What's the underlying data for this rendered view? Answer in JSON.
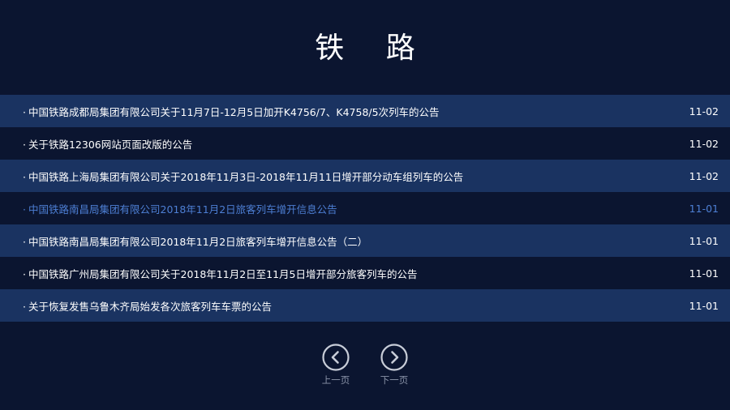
{
  "page_title": "铁 路",
  "notices": [
    {
      "title": "中国铁路成都局集团有限公司关于11月7日-12月5日加开K4756/7、K4758/5次列车的公告",
      "date": "11-02",
      "active": false
    },
    {
      "title": "关于铁路12306网站页面改版的公告",
      "date": "11-02",
      "active": false
    },
    {
      "title": "中国铁路上海局集团有限公司关于2018年11月3日-2018年11月11日增开部分动车组列车的公告",
      "date": "11-02",
      "active": false
    },
    {
      "title": "中国铁路南昌局集团有限公司2018年11月2日旅客列车增开信息公告",
      "date": "11-01",
      "active": true
    },
    {
      "title": "中国铁路南昌局集团有限公司2018年11月2日旅客列车增开信息公告（二）",
      "date": "11-01",
      "active": false
    },
    {
      "title": "中国铁路广州局集团有限公司关于2018年11月2日至11月5日增开部分旅客列车的公告",
      "date": "11-01",
      "active": false
    },
    {
      "title": "关于恢复发售乌鲁木齐局始发各次旅客列车车票的公告",
      "date": "11-01",
      "active": false
    }
  ],
  "pager": {
    "prev_label": "上一页",
    "prev_icon": "chevron-left-circle-icon",
    "next_label": "下一页",
    "next_icon": "chevron-right-circle-icon"
  },
  "colors": {
    "background": "#0b1530",
    "row_alt": "#1a3361",
    "active_text": "#4d7fd4",
    "pager_icon": "#c8cdd8",
    "pager_label": "#8a93a8"
  }
}
